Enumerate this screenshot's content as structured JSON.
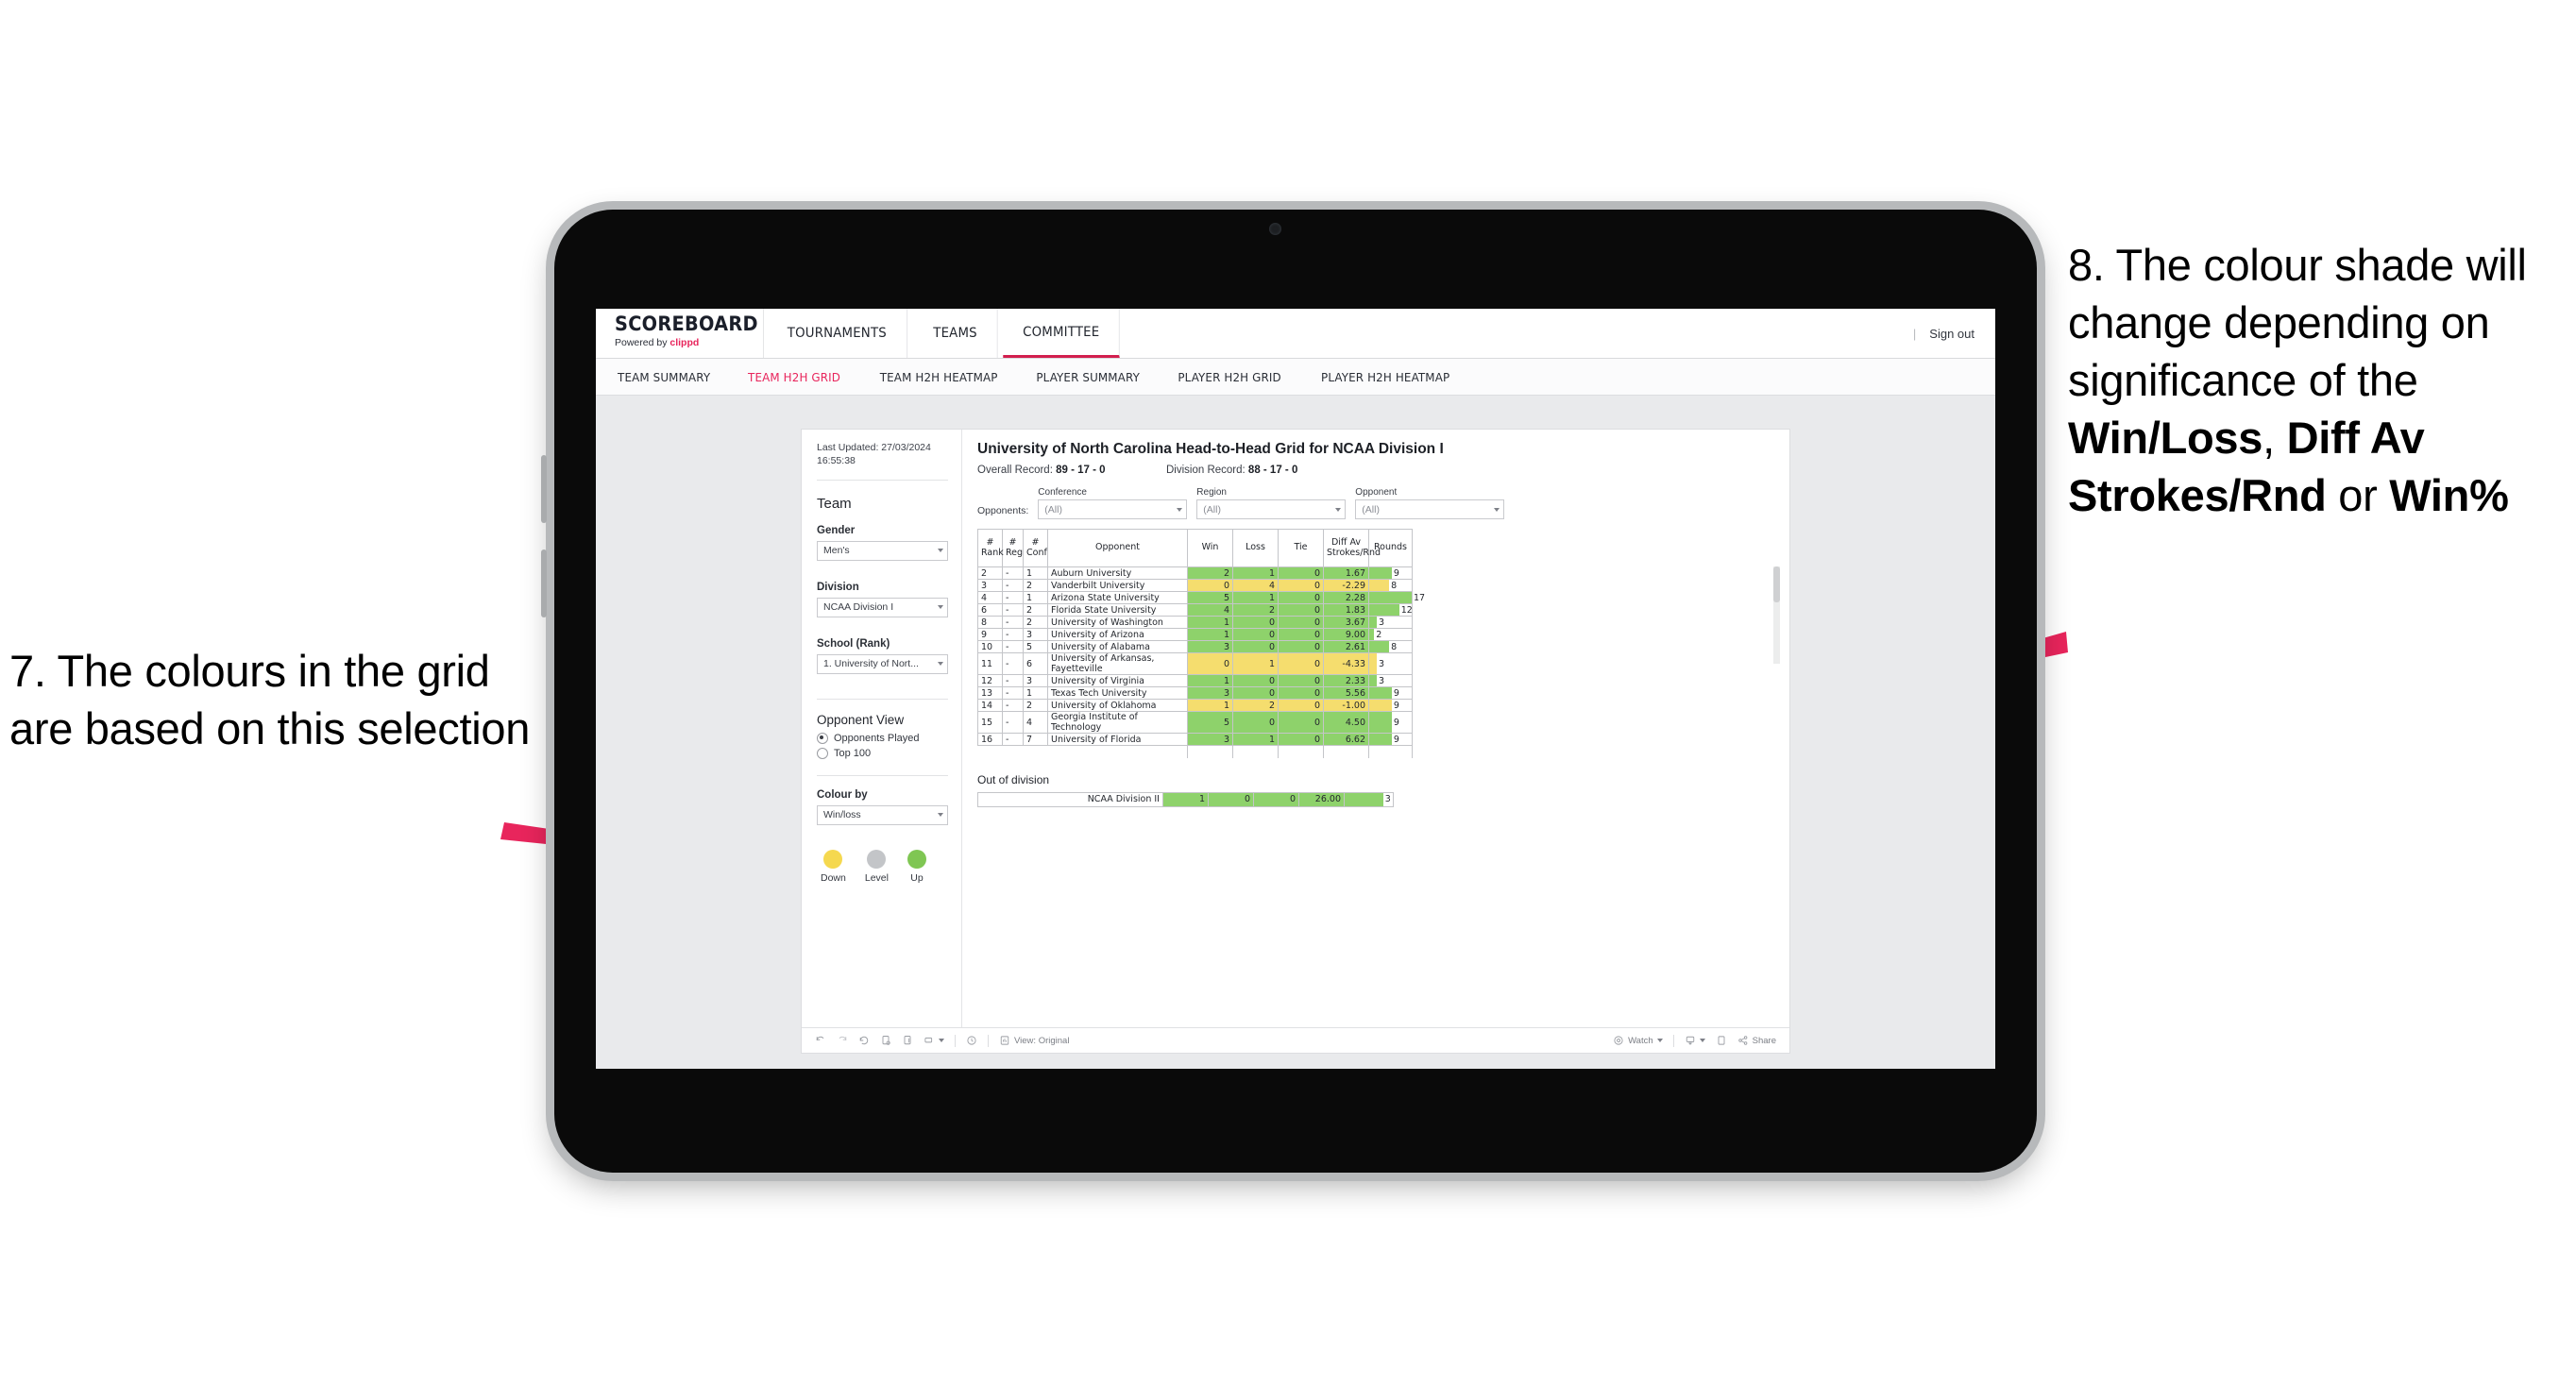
{
  "annotations": {
    "left": {
      "number": "7.",
      "text": "7. The colours in the grid are based on this selection"
    },
    "right": {
      "segments": [
        {
          "text": "8. The colour shade will change depending on significance of the ",
          "bold": false
        },
        {
          "text": "Win/Loss",
          "bold": true
        },
        {
          "text": ", ",
          "bold": false
        },
        {
          "text": "Diff Av Strokes/Rnd",
          "bold": true
        },
        {
          "text": " or ",
          "bold": false
        },
        {
          "text": "Win%",
          "bold": true
        }
      ]
    },
    "arrow_color": "#e8255c"
  },
  "header": {
    "brand_wordmark": "SCOREBOARD",
    "brand_powered_prefix": "Powered by ",
    "brand_powered_name": "clippd",
    "nav": [
      {
        "label": "TOURNAMENTS",
        "active": false
      },
      {
        "label": "TEAMS",
        "active": false
      },
      {
        "label": "COMMITTEE",
        "active": true
      }
    ],
    "signout": "Sign out",
    "divider": "|"
  },
  "subnav": [
    {
      "label": "TEAM SUMMARY",
      "active": false
    },
    {
      "label": "TEAM H2H GRID",
      "active": true
    },
    {
      "label": "TEAM H2H HEATMAP",
      "active": false
    },
    {
      "label": "PLAYER SUMMARY",
      "active": false
    },
    {
      "label": "PLAYER H2H GRID",
      "active": false
    },
    {
      "label": "PLAYER H2H HEATMAP",
      "active": false
    }
  ],
  "sidebar": {
    "last_updated": "Last Updated: 27/03/2024 16:55:38",
    "team_heading": "Team",
    "gender_label": "Gender",
    "gender_value": "Men's",
    "division_label": "Division",
    "division_value": "NCAA Division I",
    "school_label": "School (Rank)",
    "school_value": "1. University of Nort...",
    "opponent_view_heading": "Opponent View",
    "radios": [
      {
        "label": "Opponents Played",
        "selected": true
      },
      {
        "label": "Top 100",
        "selected": false
      }
    ],
    "colour_by_label": "Colour by",
    "colour_by_value": "Win/loss",
    "legend": [
      {
        "label": "Down",
        "color": "#f5d84f"
      },
      {
        "label": "Level",
        "color": "#c3c5c8"
      },
      {
        "label": "Up",
        "color": "#7fc653"
      }
    ]
  },
  "main": {
    "title": "University of North Carolina Head-to-Head Grid for NCAA Division I",
    "overall_record_label": "Overall Record: ",
    "overall_record_value": "89 - 17 - 0",
    "division_record_label": "Division Record: ",
    "division_record_value": "88 - 17 - 0",
    "opponents_label": "Opponents:",
    "filters": [
      {
        "label": "Conference",
        "value": "(All)"
      },
      {
        "label": "Region",
        "value": "(All)"
      },
      {
        "label": "Opponent",
        "value": "(All)"
      }
    ],
    "columns": [
      "# Rank",
      "# Reg",
      "# Conf",
      "Opponent",
      "Win",
      "Loss",
      "Tie",
      "Diff Av Strokes/Rnd",
      "Rounds"
    ],
    "out_of_division_title": "Out of division",
    "out_of_division_row": {
      "name": "NCAA Division II",
      "win": "1",
      "loss": "0",
      "tie": "0",
      "diff": "26.00",
      "rounds": "3",
      "color": "#8ed26b",
      "rounds_fill_pct": 80
    }
  },
  "chart_data": {
    "type": "table",
    "title": "University of North Carolina Head-to-Head Grid for NCAA Division I",
    "columns": [
      "# Rank",
      "# Reg",
      "# Conf",
      "Opponent",
      "Win",
      "Loss",
      "Tie",
      "Diff Av Strokes/Rnd",
      "Rounds"
    ],
    "colour_by": "Win/loss",
    "colour_scale": {
      "down": "#f5dd6e",
      "level": "#c3c5c8",
      "up": "#8ed26b"
    },
    "rounds_max": 17,
    "rows": [
      {
        "rank": "2",
        "reg": "-",
        "conf": "1",
        "opponent": "Auburn University",
        "win": "2",
        "loss": "1",
        "tie": "0",
        "diff": "1.67",
        "rounds": "9",
        "color": "#8ed26b"
      },
      {
        "rank": "3",
        "reg": "-",
        "conf": "2",
        "opponent": "Vanderbilt University",
        "win": "0",
        "loss": "4",
        "tie": "0",
        "diff": "-2.29",
        "rounds": "8",
        "color": "#f5dd6e"
      },
      {
        "rank": "4",
        "reg": "-",
        "conf": "1",
        "opponent": "Arizona State University",
        "win": "5",
        "loss": "1",
        "tie": "0",
        "diff": "2.28",
        "rounds": "17",
        "color": "#8ed26b"
      },
      {
        "rank": "6",
        "reg": "-",
        "conf": "2",
        "opponent": "Florida State University",
        "win": "4",
        "loss": "2",
        "tie": "0",
        "diff": "1.83",
        "rounds": "12",
        "color": "#8ed26b"
      },
      {
        "rank": "8",
        "reg": "-",
        "conf": "2",
        "opponent": "University of Washington",
        "win": "1",
        "loss": "0",
        "tie": "0",
        "diff": "3.67",
        "rounds": "3",
        "color": "#8ed26b"
      },
      {
        "rank": "9",
        "reg": "-",
        "conf": "3",
        "opponent": "University of Arizona",
        "win": "1",
        "loss": "0",
        "tie": "0",
        "diff": "9.00",
        "rounds": "2",
        "color": "#8ed26b"
      },
      {
        "rank": "10",
        "reg": "-",
        "conf": "5",
        "opponent": "University of Alabama",
        "win": "3",
        "loss": "0",
        "tie": "0",
        "diff": "2.61",
        "rounds": "8",
        "color": "#8ed26b"
      },
      {
        "rank": "11",
        "reg": "-",
        "conf": "6",
        "opponent": "University of Arkansas, Fayetteville",
        "win": "0",
        "loss": "1",
        "tie": "0",
        "diff": "-4.33",
        "rounds": "3",
        "color": "#f5dd6e"
      },
      {
        "rank": "12",
        "reg": "-",
        "conf": "3",
        "opponent": "University of Virginia",
        "win": "1",
        "loss": "0",
        "tie": "0",
        "diff": "2.33",
        "rounds": "3",
        "color": "#8ed26b"
      },
      {
        "rank": "13",
        "reg": "-",
        "conf": "1",
        "opponent": "Texas Tech University",
        "win": "3",
        "loss": "0",
        "tie": "0",
        "diff": "5.56",
        "rounds": "9",
        "color": "#8ed26b"
      },
      {
        "rank": "14",
        "reg": "-",
        "conf": "2",
        "opponent": "University of Oklahoma",
        "win": "1",
        "loss": "2",
        "tie": "0",
        "diff": "-1.00",
        "rounds": "9",
        "color": "#f5dd6e"
      },
      {
        "rank": "15",
        "reg": "-",
        "conf": "4",
        "opponent": "Georgia Institute of Technology",
        "win": "5",
        "loss": "0",
        "tie": "0",
        "diff": "4.50",
        "rounds": "9",
        "color": "#8ed26b"
      },
      {
        "rank": "16",
        "reg": "-",
        "conf": "7",
        "opponent": "University of Florida",
        "win": "3",
        "loss": "1",
        "tie": "0",
        "diff": "6.62",
        "rounds": "9",
        "color": "#8ed26b"
      }
    ]
  },
  "toolbar": {
    "left_icons": [
      "undo-icon",
      "redo-icon",
      "revert-icon",
      "refresh-icon",
      "pause-icon",
      "rectangle-select-icon"
    ],
    "clock_icon": "clock-icon",
    "view_label": "View: Original",
    "watch_label": "Watch",
    "share_label": "Share",
    "download_icon": "download-icon",
    "fullscreen_icon": "fullscreen-icon"
  }
}
